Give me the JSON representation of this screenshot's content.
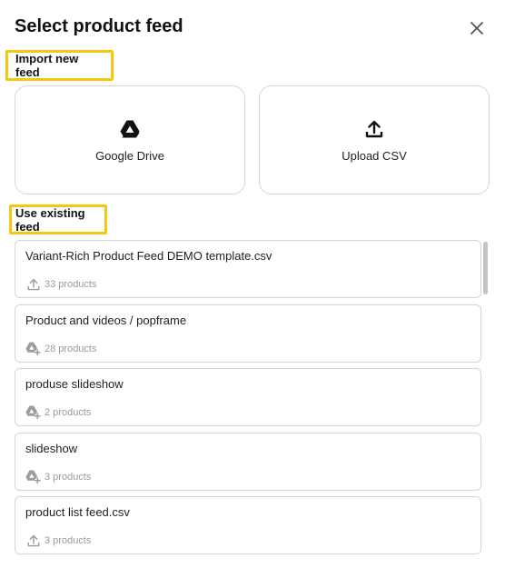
{
  "dialog": {
    "title": "Select product feed",
    "close_icon": "close-icon"
  },
  "import_section": {
    "label": "Import new feed",
    "options": [
      {
        "label": "Google Drive",
        "icon": "google-drive-icon"
      },
      {
        "label": "Upload CSV",
        "icon": "upload-icon"
      }
    ]
  },
  "existing_section": {
    "label": "Use existing feed",
    "feeds": [
      {
        "name": "Variant-Rich Product Feed DEMO template.csv",
        "count": "33 products",
        "source_icon": "upload-icon"
      },
      {
        "name": "Product and videos / popframe",
        "count": "28 products",
        "source_icon": "google-drive-add-icon"
      },
      {
        "name": "produse slideshow",
        "count": "2 products",
        "source_icon": "google-drive-add-icon"
      },
      {
        "name": "slideshow",
        "count": "3 products",
        "source_icon": "google-drive-add-icon"
      },
      {
        "name": "product list feed.csv",
        "count": "3 products",
        "source_icon": "upload-icon"
      }
    ]
  },
  "colors": {
    "highlight_border": "#f2c811",
    "card_border": "#d7d7d7",
    "meta_text": "#9b9b9b"
  }
}
